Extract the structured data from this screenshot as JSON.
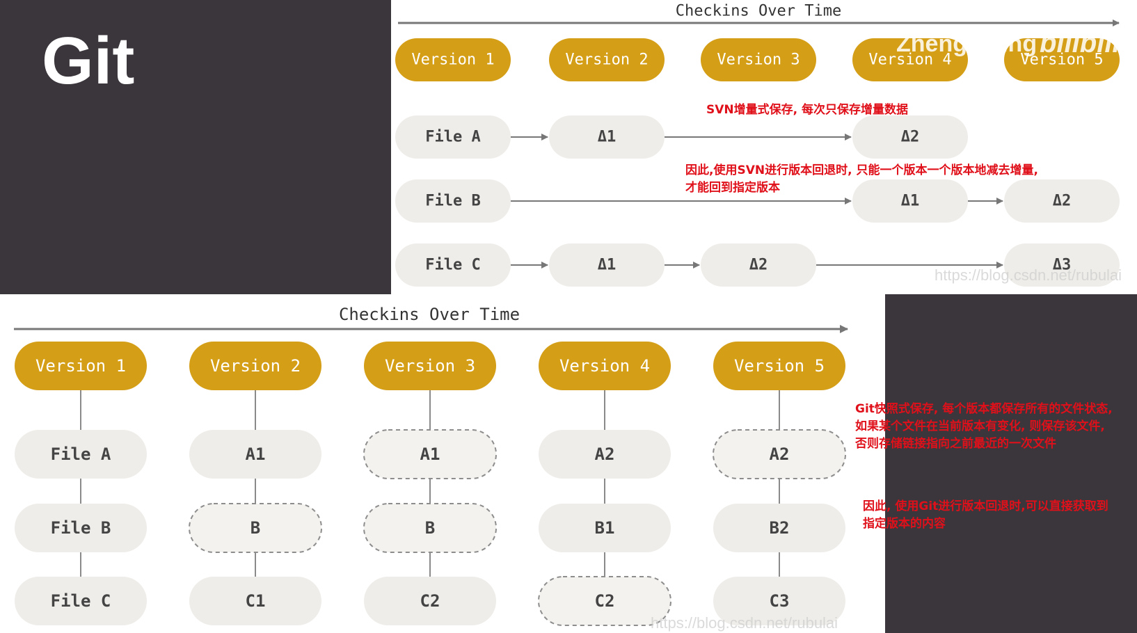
{
  "title": "Git",
  "colors": {
    "dark": "#3b363c",
    "version": "#d49e17",
    "node": "#efede9",
    "node_text": "#444444",
    "note": "#e0101a"
  },
  "svn": {
    "axis_title": "Checkins Over Time",
    "versions": [
      "Version 1",
      "Version 2",
      "Version 3",
      "Version 4",
      "Version 5"
    ],
    "files": [
      {
        "label": "File A",
        "deltas": [
          {
            "col": 2,
            "label": "Δ1"
          },
          {
            "col": 4,
            "label": "Δ2"
          }
        ]
      },
      {
        "label": "File B",
        "deltas": [
          {
            "col": 4,
            "label": "Δ1"
          },
          {
            "col": 5,
            "label": "Δ2"
          }
        ]
      },
      {
        "label": "File C",
        "deltas": [
          {
            "col": 2,
            "label": "Δ1"
          },
          {
            "col": 3,
            "label": "Δ2"
          },
          {
            "col": 5,
            "label": "Δ3"
          }
        ]
      }
    ]
  },
  "git": {
    "axis_title": "Checkins Over Time",
    "versions": [
      "Version 1",
      "Version 2",
      "Version 3",
      "Version 4",
      "Version 5"
    ],
    "columns": [
      [
        {
          "label": "File A",
          "dashed": false
        },
        {
          "label": "File B",
          "dashed": false
        },
        {
          "label": "File C",
          "dashed": false
        }
      ],
      [
        {
          "label": "A1",
          "dashed": false
        },
        {
          "label": "B",
          "dashed": true
        },
        {
          "label": "C1",
          "dashed": false
        }
      ],
      [
        {
          "label": "A1",
          "dashed": true
        },
        {
          "label": "B",
          "dashed": true
        },
        {
          "label": "C2",
          "dashed": false
        }
      ],
      [
        {
          "label": "A2",
          "dashed": false
        },
        {
          "label": "B1",
          "dashed": false
        },
        {
          "label": "C2",
          "dashed": true
        }
      ],
      [
        {
          "label": "A2",
          "dashed": true
        },
        {
          "label": "B2",
          "dashed": false
        },
        {
          "label": "C3",
          "dashed": false
        }
      ]
    ]
  },
  "notes": {
    "svn_1": "SVN增量式保存, 每次只保存增量数据",
    "svn_2_line1": "因此,使用SVN进行版本回退时, 只能一个版本一个版本地减去增量,",
    "svn_2_line2": "才能回到指定版本",
    "git_1_line1": "Git快照式保存, 每个版本都保存所有的文件状态,",
    "git_1_line2": "如果某个文件在当前版本有变化, 则保存该文件,",
    "git_1_line3": "否则存储链接指向之前最近的一次文件",
    "git_2_line1": "因此, 使用Git进行版本回退时,可以直接获取到",
    "git_2_line2": "指定版本的内容"
  },
  "watermarks": {
    "blog_top": "https://blog.csdn.net/rubulai",
    "blog_bottom": "https://blog.csdn.net/rubulai",
    "uploader": "Zhengyuling",
    "site": "bilibili"
  }
}
